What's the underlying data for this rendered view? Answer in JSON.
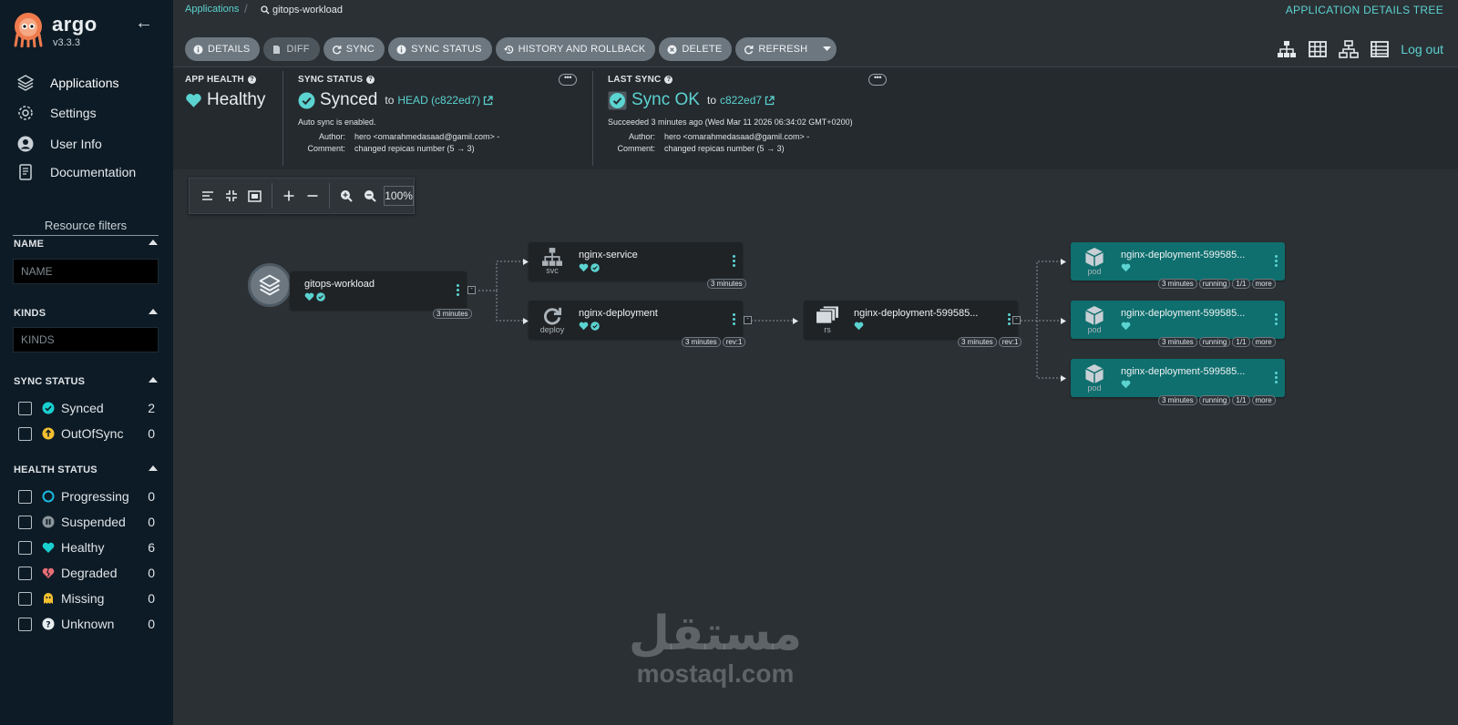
{
  "app": {
    "brand": "argo",
    "version": "v3.3.3"
  },
  "sidebar": {
    "nav": [
      {
        "label": "Applications",
        "icon": "layers-icon"
      },
      {
        "label": "Settings",
        "icon": "gear-icon"
      },
      {
        "label": "User Info",
        "icon": "user-icon"
      },
      {
        "label": "Documentation",
        "icon": "book-icon"
      }
    ],
    "resource_filters_title": "Resource filters",
    "name_section": "NAME",
    "name_placeholder": "NAME",
    "kinds_section": "KINDS",
    "kinds_placeholder": "KINDS",
    "sync_section": "SYNC STATUS",
    "sync_filters": [
      {
        "label": "Synced",
        "count": "2",
        "icon": "synced-check-icon",
        "color": "#19d0d0"
      },
      {
        "label": "OutOfSync",
        "count": "0",
        "icon": "outofsync-arrow-icon",
        "color": "#f4c030"
      }
    ],
    "health_section": "HEALTH STATUS",
    "health_filters": [
      {
        "label": "Progressing",
        "count": "0",
        "icon": "progressing-circle-icon"
      },
      {
        "label": "Suspended",
        "count": "0",
        "icon": "pause-icon"
      },
      {
        "label": "Healthy",
        "count": "6",
        "icon": "heart-icon"
      },
      {
        "label": "Degraded",
        "count": "0",
        "icon": "broken-heart-icon"
      },
      {
        "label": "Missing",
        "count": "0",
        "icon": "ghost-icon"
      },
      {
        "label": "Unknown",
        "count": "0",
        "icon": "question-icon"
      }
    ]
  },
  "header": {
    "breadcrumb_root": "Applications",
    "breadcrumb_current": "gitops-workload",
    "view_title": "APPLICATION DETAILS TREE",
    "toolbar": {
      "details": "DETAILS",
      "diff": "DIFF",
      "sync": "SYNC",
      "sync_status": "SYNC STATUS",
      "history": "HISTORY AND ROLLBACK",
      "delete": "DELETE",
      "refresh": "REFRESH"
    },
    "logout": "Log out"
  },
  "status": {
    "health_label": "APP HEALTH",
    "health_value": "Healthy",
    "sync_label": "SYNC STATUS",
    "sync_value": "Synced",
    "sync_to": "to",
    "sync_rev": "HEAD (c822ed7)",
    "auto_sync": "Auto sync is enabled.",
    "author_label": "Author:",
    "author_value": "hero <omarahmedasaad@gamil.com> -",
    "comment_label": "Comment:",
    "comment_value": "changed repicas number (5 → 3)",
    "last_sync_label": "LAST SYNC",
    "last_sync_value": "Sync OK",
    "last_sync_to": "to",
    "last_sync_rev": "c822ed7",
    "last_sync_time": "Succeeded 3 minutes ago (Wed Mar 11 2026 06:34:02 GMT+0200)",
    "last_author_value": "hero <omarahmedasaad@gamil.com> -",
    "last_comment_value": "changed repicas number (5 → 3)"
  },
  "graph": {
    "zoom": "100%",
    "app_node": {
      "name": "gitops-workload",
      "age": "3 minutes"
    },
    "svc_node": {
      "name": "nginx-service",
      "kind": "svc",
      "age": "3 minutes"
    },
    "deploy_node": {
      "name": "nginx-deployment",
      "kind": "deploy",
      "age": "3 minutes",
      "rev": "rev:1"
    },
    "rs_node": {
      "name": "nginx-deployment-599585...",
      "kind": "rs",
      "age": "3 minutes",
      "rev": "rev:1"
    },
    "pods": [
      {
        "name": "nginx-deployment-599585...",
        "kind": "pod",
        "age": "3 minutes",
        "state": "running",
        "ready": "1/1",
        "more": "more"
      },
      {
        "name": "nginx-deployment-599585...",
        "kind": "pod",
        "age": "3 minutes",
        "state": "running",
        "ready": "1/1",
        "more": "more"
      },
      {
        "name": "nginx-deployment-599585...",
        "kind": "pod",
        "age": "3 minutes",
        "state": "running",
        "ready": "1/1",
        "more": "more"
      }
    ]
  },
  "colors": {
    "accent": "#5bd3d1",
    "sidebar_bg": "#0d1b26",
    "pod_bg": "#0f6f6e",
    "healthy": "#19d0d0"
  },
  "watermark": {
    "arabic": "مستقل",
    "latin": "mostaql.com"
  }
}
